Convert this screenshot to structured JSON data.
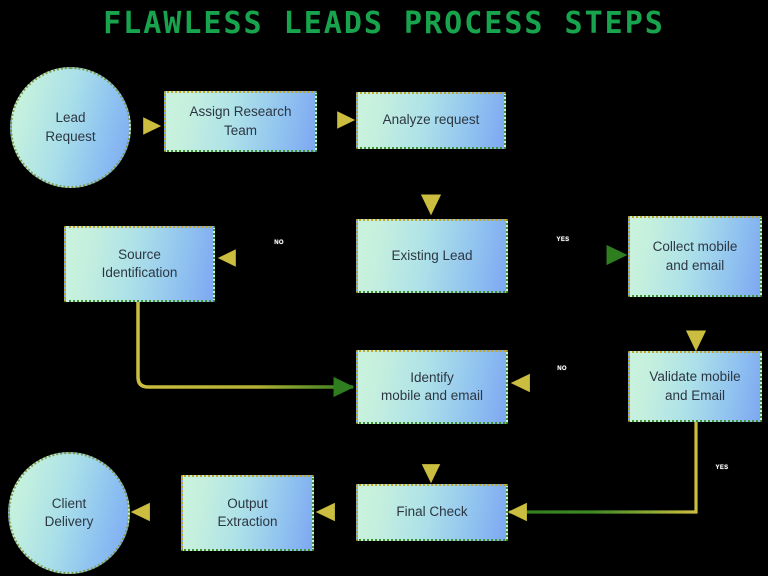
{
  "title": "FLAWLESS LEADS PROCESS STEPS",
  "theme": {
    "background": "#000000",
    "title_color": "#17a44d",
    "node_fill_start": "#c9f3dc",
    "node_fill_end": "#7ea7f2",
    "node_border_green": "#3f8f2f",
    "node_border_yellow": "#c2a828",
    "node_text": "#2c3642",
    "edge_yellow": "#cbbd3f",
    "edge_green": "#2e7d1f",
    "edge_label_color": "#ffffff"
  },
  "nodes": [
    {
      "id": "lead_request",
      "label": "Lead\nRequest",
      "shape": "circle"
    },
    {
      "id": "assign_team",
      "label": "Assign Research\nTeam",
      "shape": "rect"
    },
    {
      "id": "analyze",
      "label": "Analyze request",
      "shape": "rect"
    },
    {
      "id": "existing_lead",
      "label": "Existing Lead",
      "shape": "rect"
    },
    {
      "id": "source_ident",
      "label": "Source\nIdentification",
      "shape": "rect"
    },
    {
      "id": "collect",
      "label": "Collect mobile\nand email",
      "shape": "rect"
    },
    {
      "id": "identify",
      "label": "Identify\nmobile and email",
      "shape": "rect"
    },
    {
      "id": "validate",
      "label": "Validate mobile\nand Email",
      "shape": "rect"
    },
    {
      "id": "final_check",
      "label": "Final Check",
      "shape": "rect"
    },
    {
      "id": "output_extract",
      "label": "Output\nExtraction",
      "shape": "rect"
    },
    {
      "id": "client_delivery",
      "label": "Client\nDelivery",
      "shape": "circle"
    }
  ],
  "edges": [
    {
      "from": "lead_request",
      "to": "assign_team",
      "label": ""
    },
    {
      "from": "assign_team",
      "to": "analyze",
      "label": ""
    },
    {
      "from": "analyze",
      "to": "existing_lead",
      "label": ""
    },
    {
      "from": "existing_lead",
      "to": "source_ident",
      "label": "NO"
    },
    {
      "from": "existing_lead",
      "to": "collect",
      "label": "YES"
    },
    {
      "from": "source_ident",
      "to": "identify",
      "label": ""
    },
    {
      "from": "collect",
      "to": "validate",
      "label": ""
    },
    {
      "from": "validate",
      "to": "identify",
      "label": "NO"
    },
    {
      "from": "validate",
      "to": "final_check",
      "label": "YES"
    },
    {
      "from": "identify",
      "to": "final_check",
      "label": ""
    },
    {
      "from": "final_check",
      "to": "output_extract",
      "label": ""
    },
    {
      "from": "output_extract",
      "to": "client_delivery",
      "label": ""
    }
  ],
  "edge_labels": [
    {
      "id": "no_existing",
      "text": "NO"
    },
    {
      "id": "yes_existing",
      "text": "YES"
    },
    {
      "id": "no_validate",
      "text": "NO"
    },
    {
      "id": "yes_validate",
      "text": "YES"
    }
  ]
}
